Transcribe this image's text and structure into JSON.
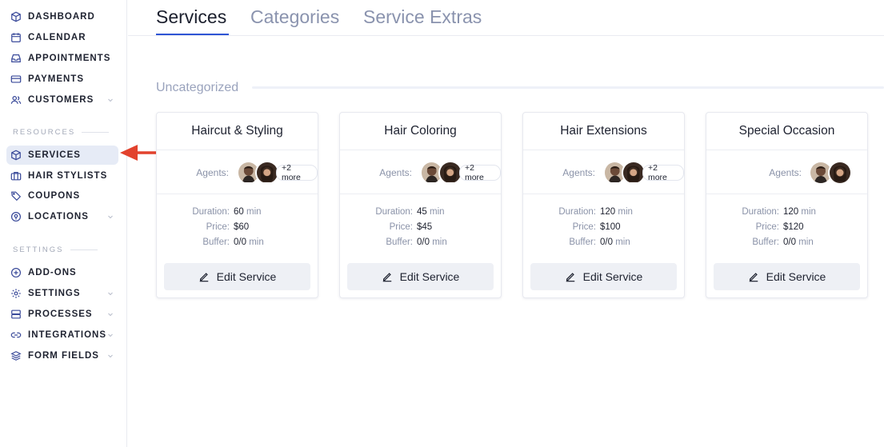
{
  "sidebar": {
    "items": [
      {
        "label": "DASHBOARD",
        "icon": "cube-icon",
        "has_chevron": false
      },
      {
        "label": "CALENDAR",
        "icon": "calendar-icon",
        "has_chevron": false
      },
      {
        "label": "APPOINTMENTS",
        "icon": "inbox-icon",
        "has_chevron": false
      },
      {
        "label": "PAYMENTS",
        "icon": "credit-card-icon",
        "has_chevron": false
      },
      {
        "label": "CUSTOMERS",
        "icon": "users-icon",
        "has_chevron": true
      }
    ],
    "resources_heading": "RESOURCES",
    "resources_items": [
      {
        "label": "SERVICES",
        "icon": "cube-icon",
        "active": true
      },
      {
        "label": "HAIR STYLISTS",
        "icon": "briefcase-icon"
      },
      {
        "label": "COUPONS",
        "icon": "tag-icon"
      },
      {
        "label": "LOCATIONS",
        "icon": "location-pin-icon",
        "has_chevron": true
      }
    ],
    "settings_heading": "SETTINGS",
    "settings_items": [
      {
        "label": "ADD-ONS",
        "icon": "plus-circle-icon"
      },
      {
        "label": "SETTINGS",
        "icon": "gear-icon",
        "has_chevron": true
      },
      {
        "label": "PROCESSES",
        "icon": "server-icon",
        "has_chevron": true
      },
      {
        "label": "INTEGRATIONS",
        "icon": "link-icon",
        "has_chevron": true
      },
      {
        "label": "FORM FIELDS",
        "icon": "layers-icon",
        "has_chevron": true
      }
    ]
  },
  "tabs": [
    {
      "label": "Services",
      "active": true
    },
    {
      "label": "Categories",
      "active": false
    },
    {
      "label": "Service Extras",
      "active": false
    }
  ],
  "group": {
    "title": "Uncategorized"
  },
  "card_labels": {
    "agents": "Agents:",
    "duration": "Duration:",
    "price": "Price:",
    "buffer": "Buffer:",
    "min_unit": "min",
    "edit": "Edit Service"
  },
  "services": [
    {
      "name": "Haircut & Styling",
      "more": "+2 more",
      "duration": "60",
      "price": "$60",
      "buffer": "0/0"
    },
    {
      "name": "Hair Coloring",
      "more": "+2 more",
      "duration": "45",
      "price": "$45",
      "buffer": "0/0"
    },
    {
      "name": "Hair Extensions",
      "more": "+2 more",
      "duration": "120",
      "price": "$100",
      "buffer": "0/0"
    },
    {
      "name": "Special Occasion",
      "more": "",
      "duration": "120",
      "price": "$120",
      "buffer": "0/0"
    }
  ],
  "colors": {
    "accent": "#2f55d4",
    "arrow": "#e2422d",
    "active_nav_bg": "#e6ebf6"
  }
}
